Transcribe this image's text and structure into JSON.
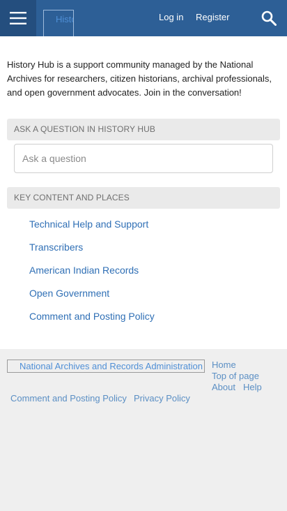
{
  "header": {
    "logo_text": "History Hub",
    "login_label": "Log in",
    "register_label": "Register"
  },
  "main": {
    "intro": "History Hub is a support community managed by the National Archives for researchers, citizen historians, archival professionals, and open government advocates. Join in the conversation!",
    "ask_section": {
      "heading": "ASK A QUESTION IN HISTORY HUB",
      "placeholder": "Ask a question",
      "value": ""
    },
    "key_section": {
      "heading": "KEY CONTENT AND PLACES",
      "links": [
        "Technical Help and Support",
        "Transcribers",
        "American Indian Records",
        "Open Government",
        "Comment and Posting Policy"
      ]
    }
  },
  "footer": {
    "logo_text": "National Archives and Records Administration",
    "home": "Home",
    "top_of_page": "Top of page",
    "about": "About",
    "help": "Help",
    "comment_policy": "Comment and Posting Policy",
    "privacy_policy": "Privacy Policy"
  },
  "colors": {
    "header_bg": "#2d5f96",
    "menu_bg": "#244e7e",
    "link": "#2f6fb5",
    "footer_link": "#5b8fc4",
    "section_head_bg": "#eaeaea",
    "footer_bg": "#efefef"
  },
  "icons": {
    "menu": "hamburger-menu-icon",
    "search": "search-icon"
  }
}
